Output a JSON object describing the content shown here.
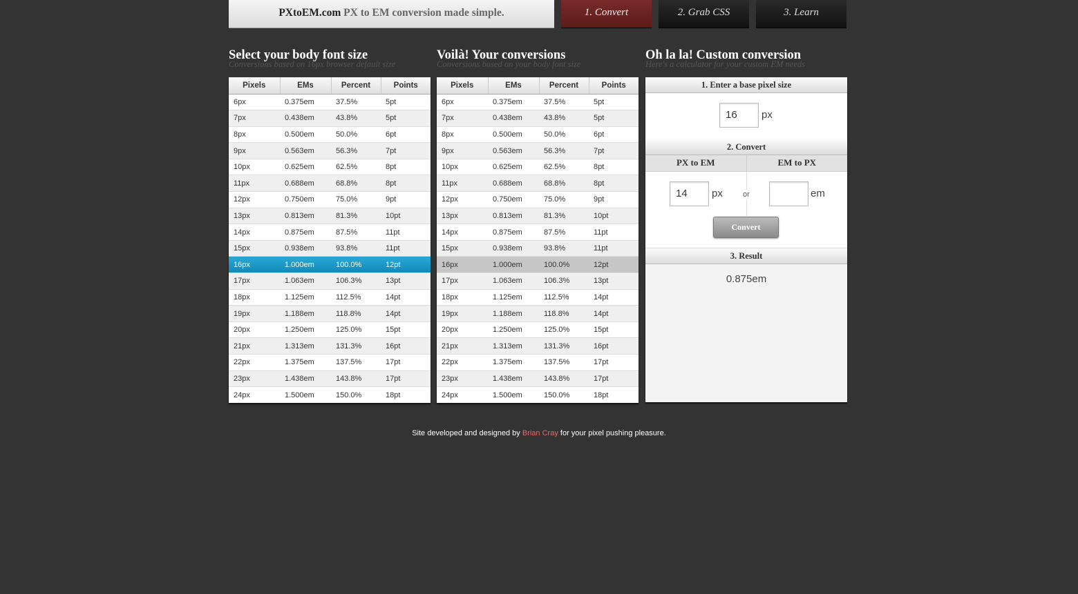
{
  "header": {
    "brand": "PXtoEM.com",
    "tagline": "PX to EM conversion made simple.",
    "tabs": [
      "1. Convert",
      "2. Grab CSS",
      "3. Learn"
    ]
  },
  "col1": {
    "title": "Select your body font size",
    "subtitle": "Conversions based on 16px browser default size"
  },
  "col2": {
    "title": "Voilà! Your conversions",
    "subtitle": "Conversions based on your body font size"
  },
  "col3": {
    "title": "Oh la la! Custom conversion",
    "subtitle": "Here's a calculator for your custom EM needs"
  },
  "table": {
    "headers": [
      "Pixels",
      "EMs",
      "Percent",
      "Points"
    ],
    "selected_index": 10,
    "rows": [
      [
        "6px",
        "0.375em",
        "37.5%",
        "5pt"
      ],
      [
        "7px",
        "0.438em",
        "43.8%",
        "5pt"
      ],
      [
        "8px",
        "0.500em",
        "50.0%",
        "6pt"
      ],
      [
        "9px",
        "0.563em",
        "56.3%",
        "7pt"
      ],
      [
        "10px",
        "0.625em",
        "62.5%",
        "8pt"
      ],
      [
        "11px",
        "0.688em",
        "68.8%",
        "8pt"
      ],
      [
        "12px",
        "0.750em",
        "75.0%",
        "9pt"
      ],
      [
        "13px",
        "0.813em",
        "81.3%",
        "10pt"
      ],
      [
        "14px",
        "0.875em",
        "87.5%",
        "11pt"
      ],
      [
        "15px",
        "0.938em",
        "93.8%",
        "11pt"
      ],
      [
        "16px",
        "1.000em",
        "100.0%",
        "12pt"
      ],
      [
        "17px",
        "1.063em",
        "106.3%",
        "13pt"
      ],
      [
        "18px",
        "1.125em",
        "112.5%",
        "14pt"
      ],
      [
        "19px",
        "1.188em",
        "118.8%",
        "14pt"
      ],
      [
        "20px",
        "1.250em",
        "125.0%",
        "15pt"
      ],
      [
        "21px",
        "1.313em",
        "131.3%",
        "16pt"
      ],
      [
        "22px",
        "1.375em",
        "137.5%",
        "17pt"
      ],
      [
        "23px",
        "1.438em",
        "143.8%",
        "17pt"
      ],
      [
        "24px",
        "1.500em",
        "150.0%",
        "18pt"
      ]
    ]
  },
  "custom": {
    "step1": "1. Enter a base pixel size",
    "base_value": "16",
    "base_unit": "px",
    "step2": "2. Convert",
    "px_to_em_label": "PX to EM",
    "em_to_px_label": "EM to PX",
    "px_value": "14",
    "px_unit": "px",
    "or_label": "or",
    "em_value": "",
    "em_unit": "em",
    "convert_button": "Convert",
    "step3": "3. Result",
    "result": "0.875em"
  },
  "footer": {
    "prefix": "Site developed and designed by",
    "author": "Brian Cray",
    "suffix": "for your pixel pushing pleasure."
  },
  "colors": {
    "selected_blue": "#1a9bcb",
    "active_tab": "#6b2222",
    "author_link": "#e86a6a"
  }
}
